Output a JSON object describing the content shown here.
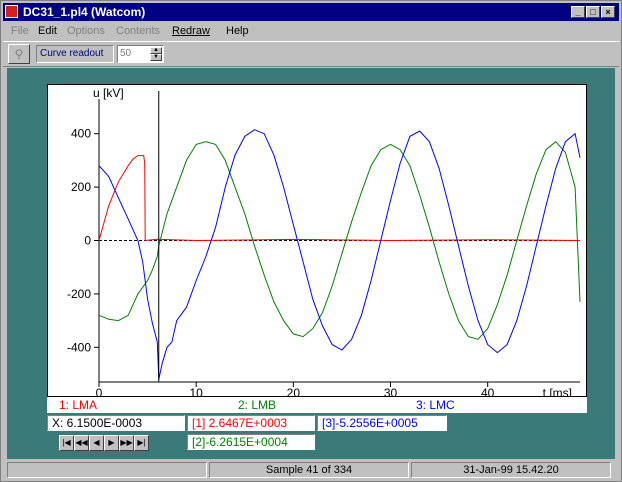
{
  "window": {
    "title": "DC31_1.pl4 (Watcom)",
    "btn_min": "_",
    "btn_max": "□",
    "btn_close": "×"
  },
  "menu": {
    "file": "File",
    "edit": "Edit",
    "options": "Options",
    "contents": "Contents",
    "redraw": "Redraw",
    "help": "Help"
  },
  "toolbar": {
    "zoom_icon": "zoom-icon",
    "curve_readout_label": "Curve readout",
    "curve_readout_value": "50"
  },
  "chart_data": {
    "type": "line",
    "ylabel": "u [kV]",
    "xlabel": "t [ms]",
    "xlim": [
      0,
      49.5
    ],
    "ylim": [
      -530,
      530
    ],
    "xticks": [
      0,
      10,
      20,
      30,
      40
    ],
    "yticks": [
      400,
      200,
      0,
      -200,
      -400
    ],
    "cursor_x": 6.15,
    "series": [
      {
        "name": "1: LMA",
        "color": "#ff0000",
        "points": [
          [
            0,
            0
          ],
          [
            1,
            130
          ],
          [
            2,
            220
          ],
          [
            3,
            280
          ],
          [
            3.5,
            305
          ],
          [
            4,
            318
          ],
          [
            4.6,
            318
          ],
          [
            4.7,
            290
          ],
          [
            4.75,
            0
          ],
          [
            6,
            5
          ],
          [
            10,
            0
          ],
          [
            20,
            4
          ],
          [
            30,
            0
          ],
          [
            40,
            3
          ],
          [
            49.5,
            0
          ]
        ]
      },
      {
        "name": "2: LMB",
        "color": "#008000",
        "points": [
          [
            0,
            -280
          ],
          [
            1,
            -295
          ],
          [
            2,
            -300
          ],
          [
            3,
            -280
          ],
          [
            4,
            -200
          ],
          [
            5,
            -150
          ],
          [
            5.5,
            -110
          ],
          [
            6,
            -60
          ],
          [
            6.15,
            -20
          ],
          [
            7,
            100
          ],
          [
            8,
            200
          ],
          [
            9,
            300
          ],
          [
            10,
            360
          ],
          [
            11,
            370
          ],
          [
            12,
            360
          ],
          [
            13,
            300
          ],
          [
            14,
            200
          ],
          [
            15,
            100
          ],
          [
            16,
            -20
          ],
          [
            17,
            -130
          ],
          [
            18,
            -230
          ],
          [
            19,
            -300
          ],
          [
            20,
            -350
          ],
          [
            21,
            -360
          ],
          [
            22,
            -330
          ],
          [
            23,
            -270
          ],
          [
            24,
            -170
          ],
          [
            25,
            -50
          ],
          [
            26,
            70
          ],
          [
            27,
            180
          ],
          [
            28,
            280
          ],
          [
            29,
            340
          ],
          [
            30,
            360
          ],
          [
            31,
            340
          ],
          [
            32,
            280
          ],
          [
            33,
            170
          ],
          [
            34,
            50
          ],
          [
            35,
            -80
          ],
          [
            36,
            -200
          ],
          [
            37,
            -300
          ],
          [
            38,
            -360
          ],
          [
            39,
            -370
          ],
          [
            40,
            -330
          ],
          [
            41,
            -240
          ],
          [
            42,
            -130
          ],
          [
            43,
            0
          ],
          [
            44,
            130
          ],
          [
            45,
            250
          ],
          [
            46,
            340
          ],
          [
            47,
            370
          ],
          [
            48,
            330
          ],
          [
            49,
            200
          ],
          [
            49.5,
            -230
          ]
        ]
      },
      {
        "name": "3: LMC",
        "color": "#0000ff",
        "points": [
          [
            0,
            280
          ],
          [
            1,
            240
          ],
          [
            2,
            160
          ],
          [
            3,
            80
          ],
          [
            4,
            0
          ],
          [
            4.5,
            -80
          ],
          [
            5,
            -220
          ],
          [
            5.5,
            -310
          ],
          [
            6,
            -380
          ],
          [
            6.15,
            -520
          ],
          [
            6.5,
            -460
          ],
          [
            7,
            -400
          ],
          [
            7.5,
            -380
          ],
          [
            8,
            -300
          ],
          [
            9,
            -250
          ],
          [
            10,
            -150
          ],
          [
            11,
            -60
          ],
          [
            12,
            50
          ],
          [
            13,
            200
          ],
          [
            14,
            320
          ],
          [
            15,
            390
          ],
          [
            16,
            415
          ],
          [
            17,
            400
          ],
          [
            18,
            320
          ],
          [
            19,
            200
          ],
          [
            20,
            60
          ],
          [
            21,
            -80
          ],
          [
            22,
            -220
          ],
          [
            23,
            -320
          ],
          [
            24,
            -390
          ],
          [
            25,
            -410
          ],
          [
            26,
            -370
          ],
          [
            27,
            -280
          ],
          [
            28,
            -150
          ],
          [
            29,
            0
          ],
          [
            30,
            150
          ],
          [
            31,
            290
          ],
          [
            32,
            390
          ],
          [
            33,
            410
          ],
          [
            34,
            370
          ],
          [
            35,
            270
          ],
          [
            36,
            130
          ],
          [
            37,
            -20
          ],
          [
            38,
            -170
          ],
          [
            39,
            -300
          ],
          [
            40,
            -390
          ],
          [
            41,
            -420
          ],
          [
            42,
            -390
          ],
          [
            43,
            -300
          ],
          [
            44,
            -170
          ],
          [
            45,
            -20
          ],
          [
            46,
            130
          ],
          [
            47,
            270
          ],
          [
            48,
            370
          ],
          [
            49,
            400
          ],
          [
            49.5,
            310
          ]
        ]
      }
    ],
    "legend_placement": "bottom",
    "grid": false
  },
  "readouts": {
    "x": "X:  6.1500E-0003",
    "s1": "[1] 2.6467E+0003",
    "s2": "[2]-6.2615E+0004",
    "s3": "[3]-5.2556E+0005"
  },
  "nav": {
    "first": "first-icon",
    "prev_page": "prev-page-icon",
    "prev": "prev-icon",
    "next": "next-icon",
    "next_page": "next-page-icon",
    "last": "last-icon"
  },
  "status": {
    "sample": "Sample 41 of 334",
    "datetime": "31-Jan-99  15.42.20"
  },
  "colors": {
    "client": "#3a7a78",
    "titlebar": "#000080"
  }
}
